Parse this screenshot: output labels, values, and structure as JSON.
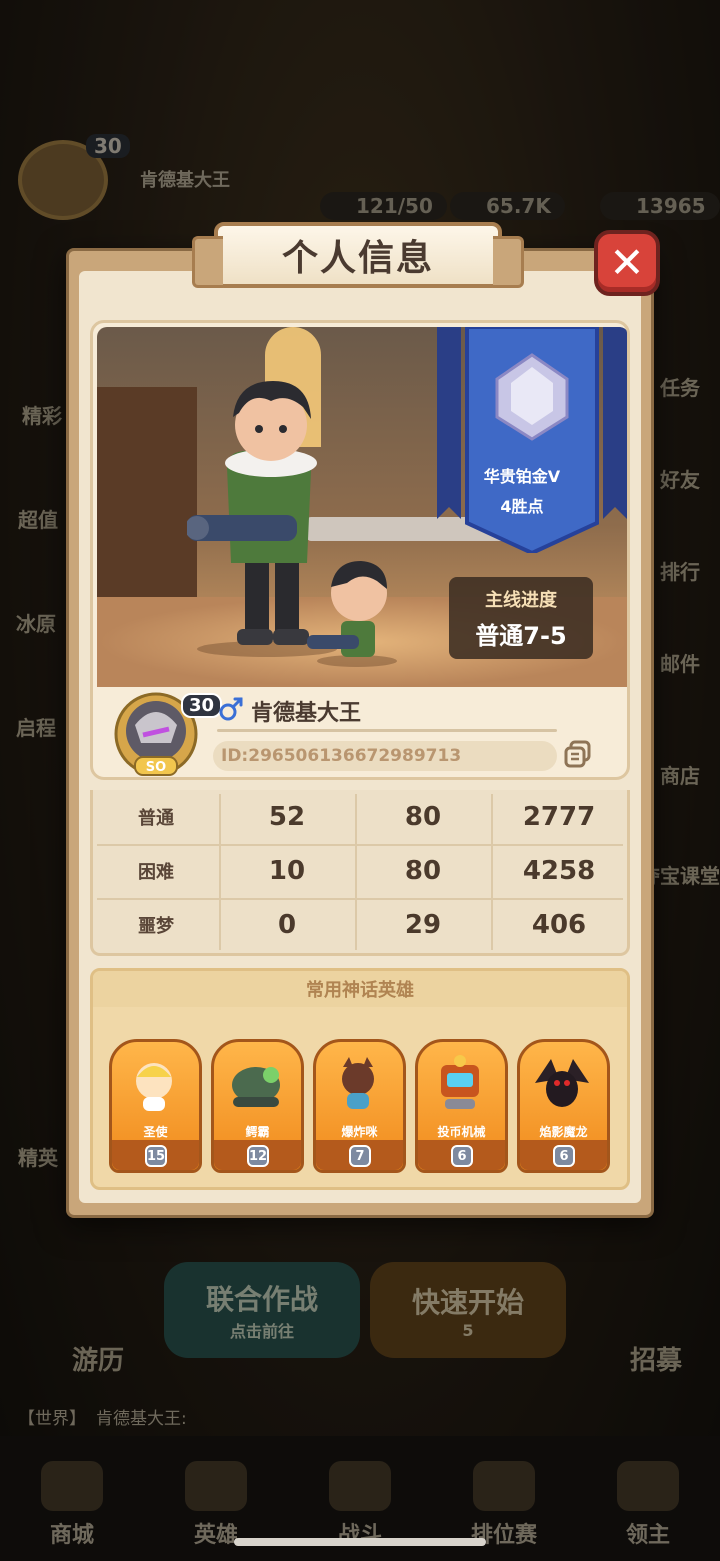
{
  "background": {
    "player_level": "30",
    "player_name": "肯德基大王",
    "resources": [
      "121/50",
      "65.7K",
      "13965"
    ],
    "side_labels_left": [
      "精彩",
      "超值",
      "冰原",
      "启程"
    ],
    "side_labels_right": [
      "任务",
      "好友",
      "排行",
      "邮件",
      "商店",
      "夺宝课堂"
    ],
    "left_button": "精英",
    "bottom_buttons": {
      "coop_title": "联合作战",
      "coop_sub": "点击前往",
      "quick_start": "快速开始",
      "quick_start_count": "5"
    },
    "corner_labels": {
      "left": "游历",
      "right": "招募"
    },
    "chat": {
      "channel": "【世界】",
      "sender": "肯德基大王:"
    },
    "nav": [
      "商城",
      "英雄",
      "战斗",
      "排位赛",
      "领主"
    ]
  },
  "modal": {
    "title": "个人信息",
    "close_icon": "close-icon",
    "rank": {
      "name": "华贵铂金V",
      "points": "4胜点"
    },
    "main_progress": {
      "label": "主线进度",
      "value": "普通7-5"
    },
    "profile": {
      "level": "30",
      "avatar_rank_text": "SO",
      "name": "肯德基大王",
      "id_text": "ID:296506136672989713",
      "gender_icon": "male-icon",
      "copy_icon": "copy-icon"
    },
    "stats": [
      {
        "label": "普通",
        "v1": "52",
        "v2": "80",
        "v3": "2777"
      },
      {
        "label": "困难",
        "v1": "10",
        "v2": "80",
        "v3": "4258"
      },
      {
        "label": "噩梦",
        "v1": "0",
        "v2": "29",
        "v3": "406"
      }
    ],
    "heroes_title": "常用神话英雄",
    "heroes": [
      {
        "name": "圣使",
        "level": "15"
      },
      {
        "name": "鳄霸",
        "level": "12"
      },
      {
        "name": "爆炸咪",
        "level": "7"
      },
      {
        "name": "投币机械",
        "level": "6"
      },
      {
        "name": "焰影魔龙",
        "level": "6"
      }
    ]
  }
}
